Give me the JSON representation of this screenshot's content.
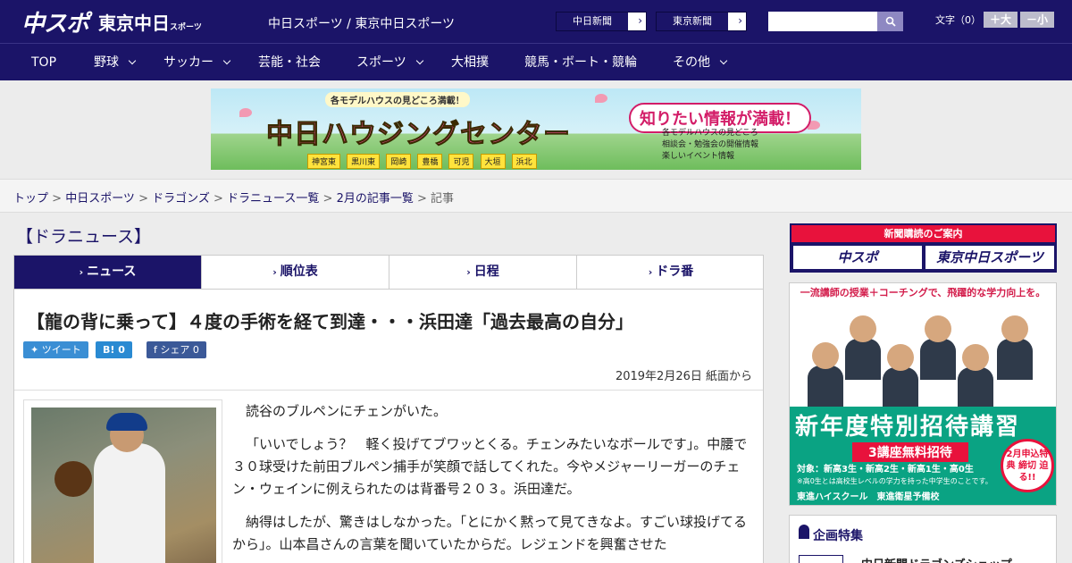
{
  "header": {
    "logo_chuspo": "中スポ",
    "logo_tokyo": "東京中日",
    "logo_tokyo_small": "スポーツ",
    "site_title": "中日スポーツ / 東京中日スポーツ",
    "links": [
      "中日新聞",
      "東京新聞"
    ],
    "search_placeholder": "",
    "font_size_label": "文字（0）",
    "font_bigger": "＋大",
    "font_smaller": "－小"
  },
  "nav": [
    {
      "label": "TOP"
    },
    {
      "label": "野球"
    },
    {
      "label": "サッカー"
    },
    {
      "label": "芸能・社会"
    },
    {
      "label": "スポーツ"
    },
    {
      "label": "大相撲"
    },
    {
      "label": "競馬・ボート・競輪"
    },
    {
      "label": "その他"
    }
  ],
  "banner": {
    "top_text": "各モデルハウスの見どころ満載！",
    "main": "中日ハウジングセンター",
    "right": "知りたい情報が満載！",
    "list": [
      "各モデルハウスの見どころ",
      "相談会・勉強会の開催情報",
      "楽しいイベント情報"
    ],
    "cities": [
      "神宮東",
      "黒川東",
      "岡崎",
      "豊橋",
      "可児",
      "大垣",
      "浜北"
    ]
  },
  "breadcrumb": {
    "items": [
      "トップ",
      "中日スポーツ",
      "ドラゴンズ",
      "ドラニュース一覧",
      "2月の記事一覧"
    ],
    "current": "記事",
    "sep": " > "
  },
  "section_title": "【ドラニュース】",
  "tabs": [
    "ニュース",
    "順位表",
    "日程",
    "ドラ番"
  ],
  "article": {
    "headline": "【龍の背に乗って】４度の手術を経て到達・・・浜田達「過去最高の自分」",
    "share": {
      "tweet": "ツイート",
      "hatena": "B! 0",
      "facebook": "シェア 0"
    },
    "date": "2019年2月26日 紙面から",
    "paragraphs": [
      "読谷のブルペンにチェンがいた。",
      "「いいでしょう？　軽く投げてブワッとくる。チェンみたいなボールです」。中腰で３０球受けた前田ブルペン捕手が笑顔で話してくれた。今やメジャーリーガーのチェン・ウェインに例えられたのは背番号２０３。浜田達だ。",
      "納得はしたが、驚きはしなかった。「とにかく黙って見てきなよ。すごい球投げてるから」。山本昌さんの言葉を聞いていたからだ。レジェンドを興奮させた"
    ]
  },
  "sidebar": {
    "subscribe_head": "新聞購読のご案内",
    "subscribe_logos": [
      "中スポ",
      "東京中日スポーツ"
    ],
    "ad_top": "一流講師の授業＋コーチングで、飛躍的な学力向上を。",
    "ad_big": "新年度特別招待講習",
    "ad_pill": "3講座無料招待",
    "ad_small": "対象：新高3生・新高2生・新高1生・高0生",
    "ad_note": "※高0生とは高校生レベルの学力を持った中学生のことです。",
    "ad_bottom": "東進ハイスクール　東進衛星予備校",
    "ad_badge": "2月申込特典 締切 迫る!!",
    "feature_title": "企画特集",
    "feature_item": "中日新聞ドラゴンズショップ"
  },
  "colors": {
    "navy": "#1b1468",
    "accent_red": "#e8123c",
    "green": "#0aa383"
  }
}
